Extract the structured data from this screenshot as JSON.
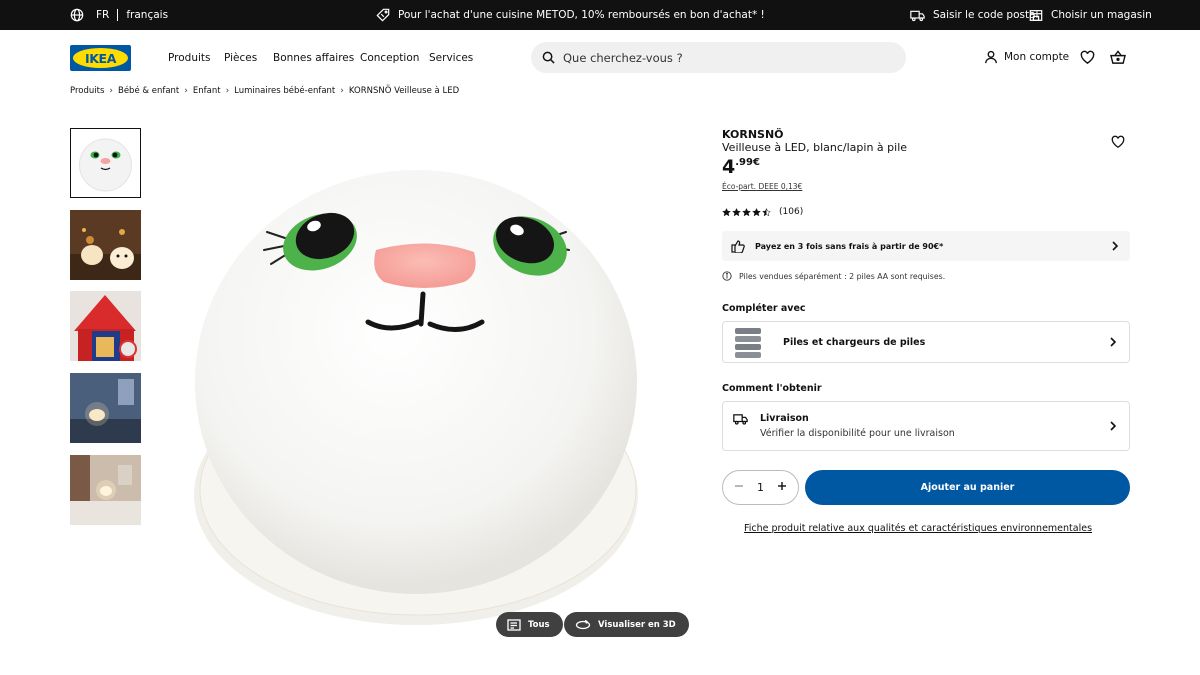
{
  "topbar": {
    "lang_code": "FR",
    "lang_name": "français",
    "promo": "Pour l'achat d'une cuisine METOD, 10% remboursés en bon d'achat* !",
    "postal": "Saisir le code postal",
    "store": "Choisir un magasin"
  },
  "header": {
    "logo_text": "IKEA",
    "nav": [
      "Produits",
      "Pièces",
      "Bonnes affaires",
      "Conception",
      "Services"
    ],
    "search_placeholder": "Que cherchez-vous ?",
    "account": "Mon compte"
  },
  "breadcrumb": [
    "Produits",
    "Bébé & enfant",
    "Enfant",
    "Luminaires bébé-enfant",
    "KORNSNÖ Veilleuse à LED"
  ],
  "gallery": {
    "all_label": "Tous",
    "view3d_label": "Visualiser en 3D"
  },
  "product": {
    "name": "KORNSNÖ",
    "description": "Veilleuse à LED, blanc/lapin à pile",
    "price_int": "4",
    "price_dec": ".99€",
    "ecopart": "Éco-part. DEEE 0,13€",
    "rating": 4.5,
    "rating_max": 5,
    "reviews": "(106)",
    "payment": "Payez en 3 fois sans frais à partir de 90€*",
    "notice": "Piles vendues séparément : 2 piles AA sont requises.",
    "complete_heading": "Compléter avec",
    "complete_item": "Piles et chargeurs de piles",
    "obtain_heading": "Comment l'obtenir",
    "delivery_title": "Livraison",
    "delivery_sub": "Vérifier la disponibilité pour une livraison",
    "quantity": "1",
    "add_to_cart": "Ajouter au panier",
    "fiche": "Fiche produit relative aux qualités et caractéristiques environnementales"
  },
  "colors": {
    "brand_blue": "#0058a3",
    "brand_yellow": "#ffdb00",
    "topbar": "#111111"
  },
  "icons": [
    "globe-icon",
    "tag-icon",
    "truck-icon",
    "store-icon",
    "search-icon",
    "user-icon",
    "heart-icon",
    "cart-icon",
    "star-icon",
    "chevron-right-icon",
    "info-icon",
    "minus-icon",
    "plus-icon",
    "grid-icon",
    "rotate-3d-icon"
  ]
}
